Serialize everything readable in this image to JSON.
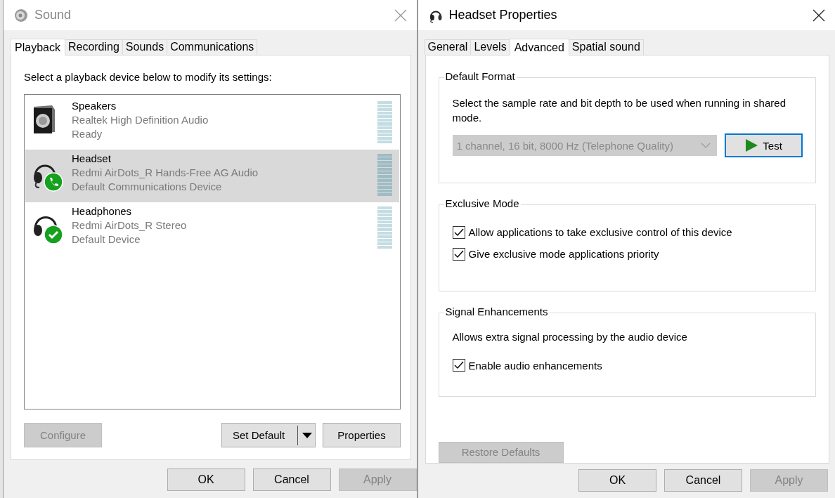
{
  "sound_window": {
    "title": "Sound",
    "tabs": [
      {
        "label": "Playback",
        "selected": true
      },
      {
        "label": "Recording",
        "selected": false
      },
      {
        "label": "Sounds",
        "selected": false
      },
      {
        "label": "Communications",
        "selected": false
      }
    ],
    "instruction": "Select a playback device below to modify its settings:",
    "devices": [
      {
        "kind": "speaker",
        "name": "Speakers",
        "driver": "Realtek High Definition Audio",
        "status": "Ready",
        "default_communications": false,
        "default_device": false,
        "selected": false
      },
      {
        "kind": "headset",
        "name": "Headset",
        "driver": "Redmi AirDots_R Hands-Free AG Audio",
        "status": "Default Communications Device",
        "default_communications": true,
        "default_device": false,
        "selected": true
      },
      {
        "kind": "headphones",
        "name": "Headphones",
        "driver": "Redmi AirDots_R Stereo",
        "status": "Default Device",
        "default_communications": false,
        "default_device": true,
        "selected": false
      }
    ],
    "list_buttons": [
      {
        "kind": "plain",
        "label": "Configure",
        "disabled": true
      },
      {
        "kind": "split",
        "label": "Set Default",
        "disabled": false
      },
      {
        "kind": "plain",
        "label": "Properties",
        "disabled": false
      }
    ],
    "dialog_buttons": [
      {
        "label": "OK",
        "disabled": false
      },
      {
        "label": "Cancel",
        "disabled": false
      },
      {
        "label": "Apply",
        "disabled": true
      }
    ]
  },
  "properties_window": {
    "title": "Headset Properties",
    "tabs": [
      {
        "label": "General",
        "selected": false
      },
      {
        "label": "Levels",
        "selected": false
      },
      {
        "label": "Advanced",
        "selected": true
      },
      {
        "label": "Spatial sound",
        "selected": false
      }
    ],
    "default_format": {
      "title": "Default Format",
      "description": "Select the sample rate and bit depth to be used when running in shared mode.",
      "format": {
        "value": "1 channel, 16 bit, 8000 Hz (Telephone Quality)",
        "disabled": true
      },
      "test_button": {
        "label": "Test",
        "focused": true
      }
    },
    "exclusive_mode": {
      "title": "Exclusive Mode",
      "options": [
        {
          "label": "Allow applications to take exclusive control of this device",
          "checked": true
        },
        {
          "label": "Give exclusive mode applications priority",
          "checked": true
        }
      ]
    },
    "signal_enhancements": {
      "title": "Signal Enhancements",
      "description": "Allows extra signal processing by the audio device",
      "options": [
        {
          "label": "Enable audio enhancements",
          "checked": true
        }
      ]
    },
    "restore_button": {
      "label": "Restore Defaults",
      "disabled": true
    },
    "dialog_buttons": [
      {
        "label": "OK",
        "disabled": false
      },
      {
        "label": "Cancel",
        "disabled": false
      },
      {
        "label": "Apply",
        "disabled": true
      }
    ]
  }
}
